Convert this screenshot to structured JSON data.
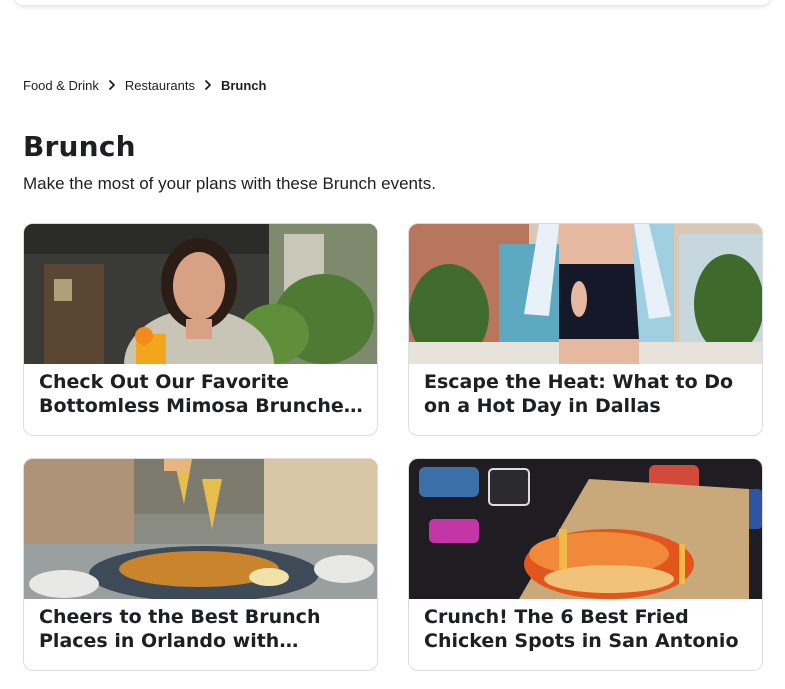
{
  "breadcrumb": {
    "items": [
      {
        "label": "Food & Drink"
      },
      {
        "label": "Restaurants"
      }
    ],
    "current": "Brunch"
  },
  "page": {
    "title": "Brunch",
    "subtitle": "Make the most of your plans with these Brunch events."
  },
  "cards": [
    {
      "title": "Check Out Our Favorite Bottomless Mimosa Brunches in Dallas",
      "image": "woman-with-mimosa-restaurant"
    },
    {
      "title": "Escape the Heat: What to Do on a Hot Day in Dallas",
      "image": "woman-swimsuit-rooftop-pool"
    },
    {
      "title": "Cheers to the Best Brunch Places in Orlando with Bottomless Mimosas",
      "image": "mimosa-toast-brunch-table"
    },
    {
      "title": "Crunch! The 6 Best Fried Chicken Spots in San Antonio",
      "image": "fried-chicken-sandwich-neon"
    }
  ]
}
